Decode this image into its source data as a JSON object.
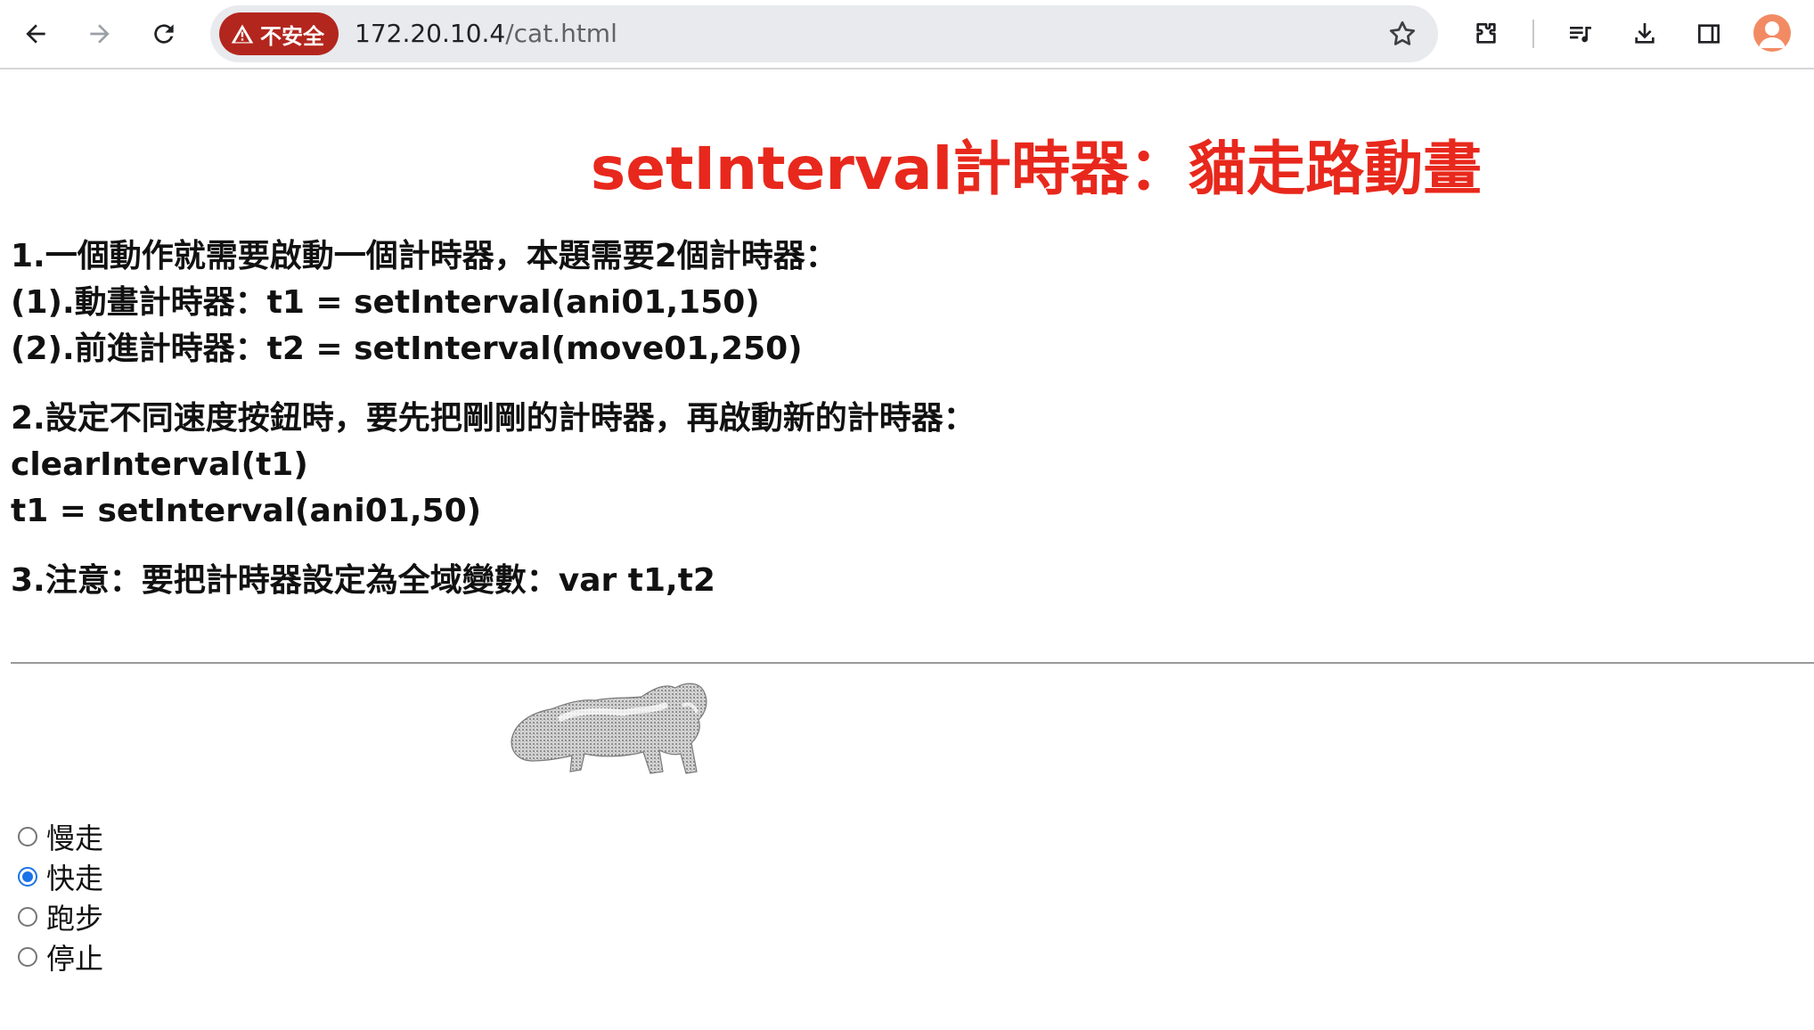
{
  "browser": {
    "security_chip": "不安全",
    "url_host": "172.20.10.4",
    "url_path": "/cat.html"
  },
  "page": {
    "title": "setInterval計時器：貓走路動畫",
    "notes": [
      [
        "1.一個動作就需要啟動一個計時器，本題需要2個計時器：",
        "(1).動畫計時器：t1 = setInterval(ani01,150)",
        "(2).前進計時器：t2 = setInterval(move01,250)"
      ],
      [
        "2.設定不同速度按鈕時，要先把剛剛的計時器，再啟動新的計時器：",
        "clearInterval(t1)",
        "t1 = setInterval(ani01,50)"
      ],
      [
        "3.注意：要把計時器設定為全域變數：var t1,t2"
      ]
    ],
    "speed_options": [
      {
        "label": "慢走",
        "checked": false
      },
      {
        "label": "快走",
        "checked": true
      },
      {
        "label": "跑步",
        "checked": false
      },
      {
        "label": "停止",
        "checked": false
      }
    ]
  }
}
